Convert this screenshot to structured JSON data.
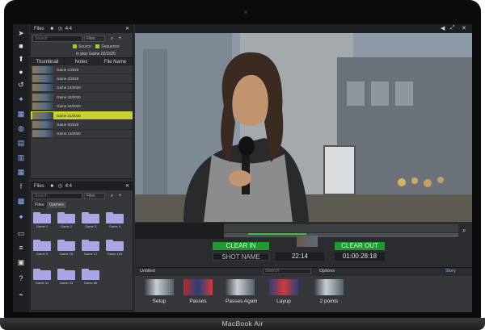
{
  "device": {
    "brand": "MacBook Air"
  },
  "files_panel": {
    "title": "Files",
    "count": "4:4",
    "search_placeholder": "Search",
    "filter": "Files",
    "check_source": "Source",
    "check_sequence": "Sequence",
    "playing": "in play Game 02/2020",
    "columns": [
      "Thumbnail",
      "Notes",
      "File Name"
    ],
    "rows": [
      {
        "name": "Game 1/2020",
        "selected": false
      },
      {
        "name": "Game 2/2020",
        "selected": false
      },
      {
        "name": "Game 14/2020",
        "selected": false
      },
      {
        "name": "Game 22/2020",
        "selected": false
      },
      {
        "name": "Game 16/2020",
        "selected": false
      },
      {
        "name": "Game 21/2020",
        "selected": true
      },
      {
        "name": "Game 8/2020",
        "selected": false
      },
      {
        "name": "Game 13/2020",
        "selected": false
      }
    ]
  },
  "games_panel": {
    "title": "Files",
    "count": "4:4",
    "search_placeholder": "Search",
    "filter": "Files",
    "tabs": [
      "Files",
      "Games"
    ],
    "folders": [
      "Game 1",
      "Game 2",
      "Game 3",
      "Game 4",
      "Game 5",
      "Game 16",
      "Game 17",
      "Game 100",
      "Game 31",
      "Game 23",
      "Game 66"
    ]
  },
  "controls": {
    "clear_in": "CLEAR IN",
    "clear_out": "CLEAR OUT",
    "shot_name": "SHOT NAME",
    "duration": "22:14",
    "timecode": "01:00:28:18"
  },
  "story": {
    "title": "Untitled",
    "search_placeholder": "Search",
    "options": "Options",
    "mode": "Story",
    "clips": [
      "Setup",
      "Passes",
      "Passes Again",
      "Layup",
      "2 points"
    ]
  },
  "colors": {
    "accent_green": "#1f9a31",
    "selection_yellow": "#c9d12f",
    "folder": "#a9a6e6"
  }
}
